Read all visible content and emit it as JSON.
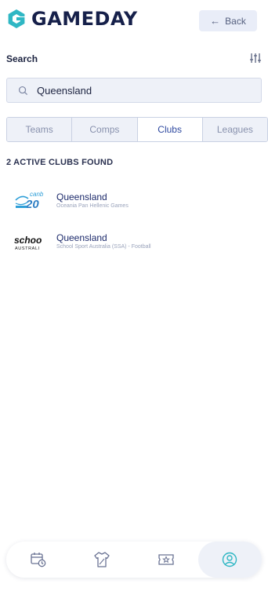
{
  "header": {
    "brand": "GAMEDAY",
    "back_label": "Back",
    "brand_color": "#16204a",
    "accent_color": "#2fb7c4"
  },
  "search": {
    "title": "Search",
    "value": "Queensland",
    "placeholder": "Search"
  },
  "tabs": [
    {
      "label": "Teams",
      "active": false
    },
    {
      "label": "Comps",
      "active": false
    },
    {
      "label": "Clubs",
      "active": true
    },
    {
      "label": "Leagues",
      "active": false
    }
  ],
  "results": {
    "count_label": "2 ACTIVE CLUBS FOUND",
    "items": [
      {
        "name": "Queensland",
        "subtitle": "Oceania Pan Hellenic Games",
        "logo": "canberra-2019-logo",
        "logo_text": "canb 20"
      },
      {
        "name": "Queensland",
        "subtitle": "School Sport Australia (SSA) - Football",
        "logo": "school-sport-australia-logo",
        "logo_text": "schoo",
        "logo_subtext": "AUSTRALI"
      }
    ]
  },
  "bottom_nav": [
    {
      "icon": "calendar-clock-icon",
      "active": false
    },
    {
      "icon": "jersey-icon",
      "active": false
    },
    {
      "icon": "ticket-star-icon",
      "active": false
    },
    {
      "icon": "user-icon",
      "active": true
    }
  ]
}
